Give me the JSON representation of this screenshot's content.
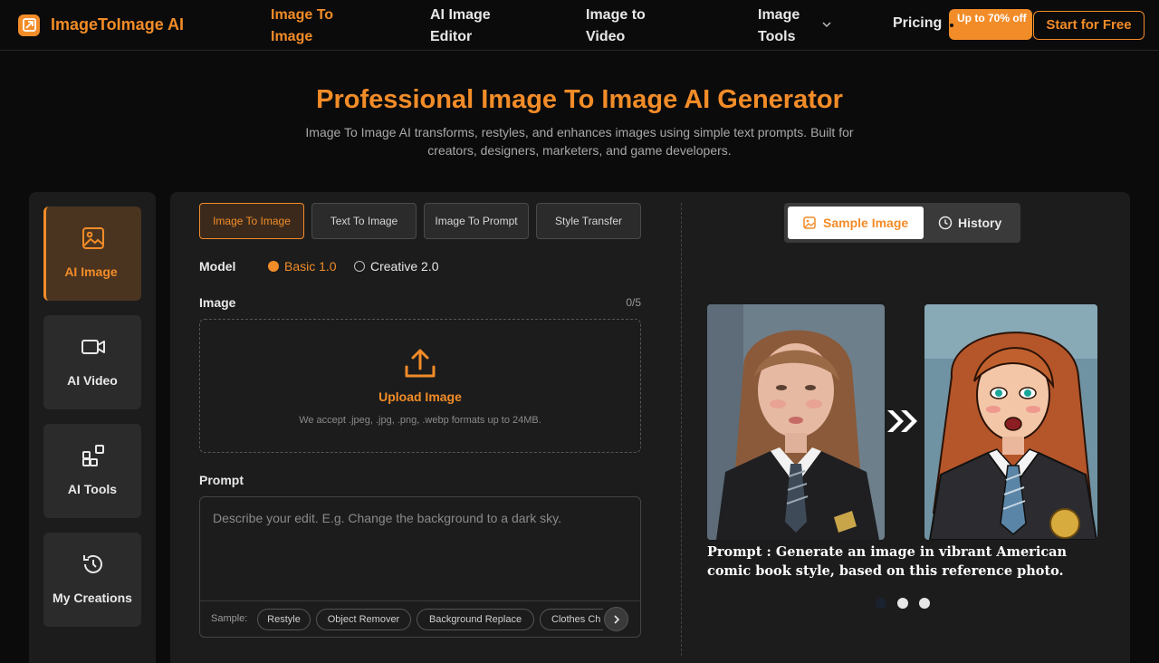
{
  "header": {
    "brand": "ImageToImage AI",
    "nav": [
      "Image To Image",
      "AI Image Editor",
      "Image to Video",
      "Image Tools"
    ],
    "nav_lines": [
      [
        "Image To",
        "Image"
      ],
      [
        "AI Image",
        "Editor"
      ],
      [
        "Image to",
        "Video"
      ],
      [
        "Image",
        "Tools"
      ]
    ],
    "pricing": "Pricing",
    "discount_badge": "Up to 70% off",
    "start_button": "Start for Free"
  },
  "hero": {
    "title": "Professional Image To Image AI Generator",
    "subtitle": "Image To Image AI transforms, restyles, and enhances images using simple text prompts. Built for creators, designers, marketers, and game developers."
  },
  "sidebar": {
    "items": [
      {
        "label": "AI Image",
        "icon": "image-icon",
        "active": true
      },
      {
        "label": "AI Video",
        "icon": "video-icon",
        "active": false
      },
      {
        "label": "AI Tools",
        "icon": "tools-grid-icon",
        "active": false
      },
      {
        "label": "My Creations",
        "icon": "history-icon",
        "active": false
      }
    ]
  },
  "tabs": [
    {
      "label": "Image To Image",
      "active": true
    },
    {
      "label": "Text To Image",
      "active": false
    },
    {
      "label": "Image To Prompt",
      "active": false
    },
    {
      "label": "Style Transfer",
      "active": false
    }
  ],
  "model": {
    "label": "Model",
    "options": [
      {
        "label": "Basic 1.0",
        "selected": true
      },
      {
        "label": "Creative 2.0",
        "selected": false
      }
    ]
  },
  "image_upload": {
    "label": "Image",
    "count": "0/5",
    "title": "Upload Image",
    "note": "We accept .jpeg, .jpg, .png, .webp formats up to 24MB."
  },
  "prompt": {
    "label": "Prompt",
    "placeholder": "Describe your edit. E.g. Change the background to a dark sky.",
    "sample_label": "Sample:",
    "samples": [
      "Restyle",
      "Object Remover",
      "Background Replace",
      "Clothes Ch"
    ]
  },
  "preview": {
    "toggle_sample": "Sample Image",
    "toggle_history": "History",
    "caption": "Prompt : Generate an image in vibrant American comic book style, based on this reference photo.",
    "active_slide": 1,
    "slide_count": 3
  },
  "colors": {
    "accent": "#f28c28",
    "background": "#0b0b0b",
    "panel": "#1c1c1c"
  }
}
